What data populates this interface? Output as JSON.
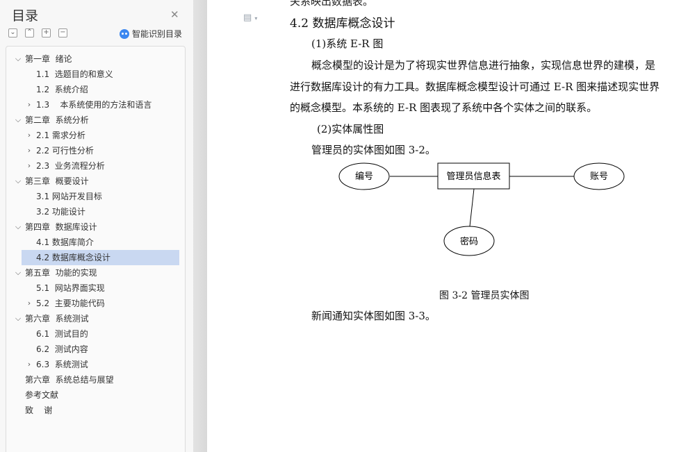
{
  "sidebar": {
    "title": "目录",
    "smart_label": "智能识别目录",
    "tools": [
      {
        "name": "expand-all-icon",
        "glyph": "⌄"
      },
      {
        "name": "collapse-all-icon",
        "glyph": "⌃"
      },
      {
        "name": "add-heading-icon",
        "glyph": "+"
      },
      {
        "name": "remove-heading-icon",
        "glyph": "−"
      }
    ],
    "toc": [
      {
        "label": "第一章  绪论",
        "level": 0,
        "arrow": "down"
      },
      {
        "label": "1.1  选题目的和意义",
        "level": 1,
        "arrow": "none"
      },
      {
        "label": "1.2  系统介绍",
        "level": 1,
        "arrow": "none"
      },
      {
        "label": "1.3    本系统使用的方法和语言",
        "level": 1,
        "arrow": "right"
      },
      {
        "label": "第二章  系统分析",
        "level": 0,
        "arrow": "down"
      },
      {
        "label": "2.1 需求分析",
        "level": 1,
        "arrow": "right"
      },
      {
        "label": "2.2 可行性分析",
        "level": 1,
        "arrow": "right"
      },
      {
        "label": "2.3  业务流程分析",
        "level": 1,
        "arrow": "right"
      },
      {
        "label": "第三章  概要设计",
        "level": 0,
        "arrow": "down"
      },
      {
        "label": "3.1 网站开发目标",
        "level": 1,
        "arrow": "none"
      },
      {
        "label": "3.2 功能设计",
        "level": 1,
        "arrow": "none"
      },
      {
        "label": "第四章  数据库设计",
        "level": 0,
        "arrow": "down"
      },
      {
        "label": "4.1 数据库简介",
        "level": 1,
        "arrow": "none"
      },
      {
        "label": "4.2 数据库概念设计",
        "level": 1,
        "arrow": "none",
        "active": true
      },
      {
        "label": "第五章  功能的实现",
        "level": 0,
        "arrow": "down"
      },
      {
        "label": "5.1  网站界面实现",
        "level": 1,
        "arrow": "none"
      },
      {
        "label": "5.2  主要功能代码",
        "level": 1,
        "arrow": "right"
      },
      {
        "label": "第六章  系统测试",
        "level": 0,
        "arrow": "down"
      },
      {
        "label": "6.1  测试目的",
        "level": 1,
        "arrow": "none"
      },
      {
        "label": "6.2  测试内容",
        "level": 1,
        "arrow": "none"
      },
      {
        "label": "6.3  系统测试",
        "level": 1,
        "arrow": "right"
      },
      {
        "label": "第六章  系统总结与展望",
        "level": 0,
        "arrow": "none"
      },
      {
        "label": "参考文献",
        "level": 0,
        "arrow": "none"
      },
      {
        "label": "致    谢",
        "level": 0,
        "arrow": "none"
      }
    ]
  },
  "document": {
    "top_cut_text": "关系映出数据表。",
    "heading": "4.2 数据库概念设计",
    "sub1": "(1)系统 E-R 图",
    "para_lines": [
      "概念模型的设计是为了将现实世界信息进行抽象，实现信息世界的建模，是",
      "进行数据库设计的有力工具。数据库概念模型设计可通过 E-R 图来描述现实世界",
      "的概念模型。本系统的 E-R 图表现了系统中各个实体之间的联系。"
    ],
    "sub2": "(2)实体属性图",
    "intro1": "管理员的实体图如图 3-2。",
    "er": {
      "entity": "管理员信息表",
      "attr_left": "编号",
      "attr_right": "账号",
      "attr_bottom": "密码"
    },
    "caption": "图 3-2 管理员实体图",
    "intro2": "新闻通知实体图如图 3-3。"
  }
}
